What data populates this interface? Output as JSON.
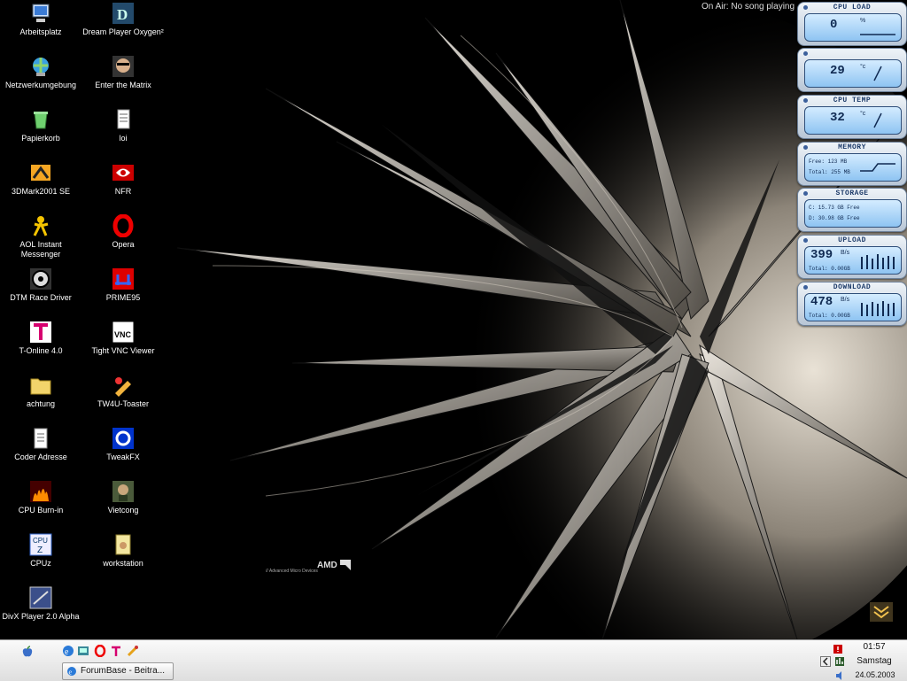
{
  "desktop": {
    "icons_left": [
      {
        "label": "Arbeitsplatz",
        "icon": "computer-icon"
      },
      {
        "label": "Netzwerkumgebung",
        "icon": "network-icon"
      },
      {
        "label": "Papierkorb",
        "icon": "recycle-bin-icon"
      },
      {
        "label": "3DMark2001 SE",
        "icon": "3dmark-icon"
      },
      {
        "label": "AOL Instant Messenger",
        "icon": "aim-icon"
      },
      {
        "label": "DTM Race Driver",
        "icon": "race-driver-icon"
      },
      {
        "label": "T-Online 4.0",
        "icon": "t-online-icon"
      },
      {
        "label": "achtung",
        "icon": "folder-icon"
      },
      {
        "label": "Coder Adresse",
        "icon": "document-icon"
      },
      {
        "label": "CPU Burn-in",
        "icon": "fire-icon"
      },
      {
        "label": "CPUz",
        "icon": "cpuz-icon"
      },
      {
        "label": "DivX Player 2.0 Alpha",
        "icon": "divx-icon"
      }
    ],
    "icons_right": [
      {
        "label": "Dream Player Oxygen²",
        "icon": "dream-player-icon"
      },
      {
        "label": "Enter the Matrix",
        "icon": "matrix-icon"
      },
      {
        "label": "loi",
        "icon": "text-file-icon"
      },
      {
        "label": "NFR",
        "icon": "nvidia-icon"
      },
      {
        "label": "Opera",
        "icon": "opera-icon"
      },
      {
        "label": "PRIME95",
        "icon": "prime95-icon"
      },
      {
        "label": "Tight VNC Viewer",
        "icon": "vnc-icon"
      },
      {
        "label": "TW4U-Toaster",
        "icon": "toaster-icon"
      },
      {
        "label": "TweakFX",
        "icon": "tweakfx-icon"
      },
      {
        "label": "Vietcong",
        "icon": "vietcong-icon"
      },
      {
        "label": "workstation",
        "icon": "archive-icon"
      }
    ],
    "wallpaper_brand": "AMD",
    "wallpaper_tagline": "// Advanced Micro Devices"
  },
  "now_playing": "On Air: No song playing",
  "gadgets": [
    {
      "title": "CPU LOAD",
      "value": "0",
      "unit": "%"
    },
    {
      "title": "",
      "value": "29",
      "unit": "°c"
    },
    {
      "title": "CPU TEMP",
      "value": "32",
      "unit": "°c"
    },
    {
      "title": "MEMORY",
      "line1": "Free: 123 MB",
      "line2": "Total: 255 MB"
    },
    {
      "title": "STORAGE",
      "line1": "C: 15.73 GB Free",
      "line2": "D: 30.98 GB Free"
    },
    {
      "title": "UPLOAD",
      "value": "399",
      "unit": "B/s",
      "line1": "Total: 0.00GB"
    },
    {
      "title": "DOWNLOAD",
      "value": "478",
      "unit": "B/s",
      "line1": "Total: 0.00GB"
    }
  ],
  "taskbar": {
    "task_label": "ForumBase - Beitra...",
    "clock_time": "01:57",
    "clock_day": "Samstag",
    "clock_date": "24.05.2003"
  },
  "colors": {
    "taskbar": "#e8e8e8",
    "gadget_screen": "#a6d3f7",
    "desktop": "#000000"
  }
}
